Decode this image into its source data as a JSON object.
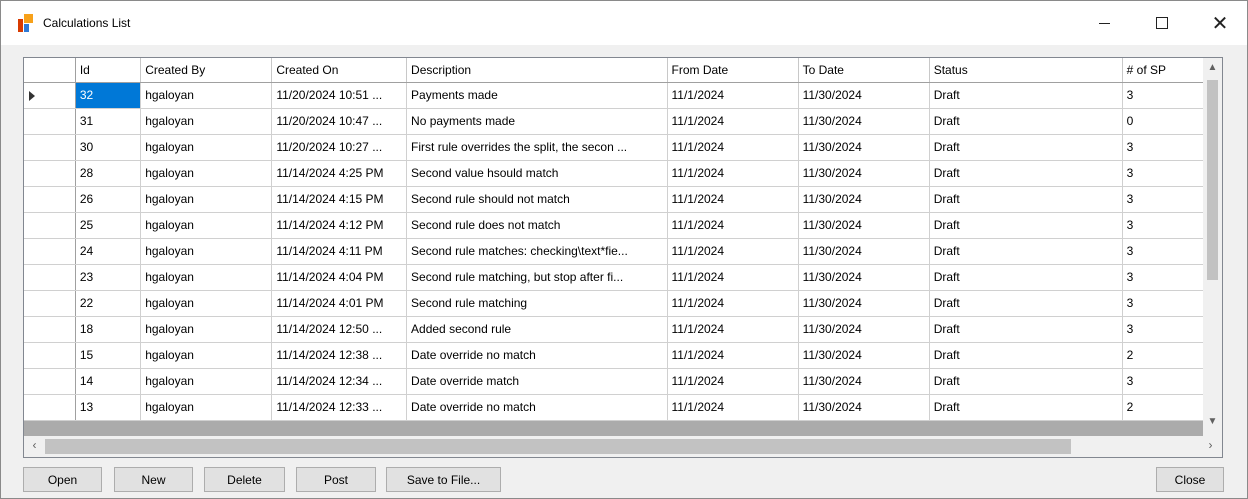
{
  "window": {
    "title": "Calculations List",
    "controls": {
      "minimize": "—",
      "maximize": "☐",
      "close": "✕"
    }
  },
  "grid": {
    "columns": [
      "Id",
      "Created By",
      "Created On",
      "Description",
      "From Date",
      "To Date",
      "Status",
      "# of SP"
    ],
    "rows": [
      {
        "id": "32",
        "created_by": "hgaloyan",
        "created_on": "11/20/2024 10:51 ...",
        "description": "Payments made",
        "from_date": "11/1/2024",
        "to_date": "11/30/2024",
        "status": "Draft",
        "sp": "3"
      },
      {
        "id": "31",
        "created_by": "hgaloyan",
        "created_on": "11/20/2024 10:47 ...",
        "description": "No payments made",
        "from_date": "11/1/2024",
        "to_date": "11/30/2024",
        "status": "Draft",
        "sp": "0"
      },
      {
        "id": "30",
        "created_by": "hgaloyan",
        "created_on": "11/20/2024 10:27 ...",
        "description": "First rule overrides the split, the secon ...",
        "from_date": "11/1/2024",
        "to_date": "11/30/2024",
        "status": "Draft",
        "sp": "3"
      },
      {
        "id": "28",
        "created_by": "hgaloyan",
        "created_on": "11/14/2024 4:25 PM",
        "description": "Second value hsould match",
        "from_date": "11/1/2024",
        "to_date": "11/30/2024",
        "status": "Draft",
        "sp": "3"
      },
      {
        "id": "26",
        "created_by": "hgaloyan",
        "created_on": "11/14/2024 4:15 PM",
        "description": "Second rule should not match",
        "from_date": "11/1/2024",
        "to_date": "11/30/2024",
        "status": "Draft",
        "sp": "3"
      },
      {
        "id": "25",
        "created_by": "hgaloyan",
        "created_on": "11/14/2024 4:12 PM",
        "description": "Second rule does not match",
        "from_date": "11/1/2024",
        "to_date": "11/30/2024",
        "status": "Draft",
        "sp": "3"
      },
      {
        "id": "24",
        "created_by": "hgaloyan",
        "created_on": "11/14/2024 4:11 PM",
        "description": "Second rule matches: checking\\text*fie...",
        "from_date": "11/1/2024",
        "to_date": "11/30/2024",
        "status": "Draft",
        "sp": "3"
      },
      {
        "id": "23",
        "created_by": "hgaloyan",
        "created_on": "11/14/2024 4:04 PM",
        "description": "Second rule matching, but stop after fi...",
        "from_date": "11/1/2024",
        "to_date": "11/30/2024",
        "status": "Draft",
        "sp": "3"
      },
      {
        "id": "22",
        "created_by": "hgaloyan",
        "created_on": "11/14/2024 4:01 PM",
        "description": "Second rule matching",
        "from_date": "11/1/2024",
        "to_date": "11/30/2024",
        "status": "Draft",
        "sp": "3"
      },
      {
        "id": "18",
        "created_by": "hgaloyan",
        "created_on": "11/14/2024 12:50 ...",
        "description": "Added second rule",
        "from_date": "11/1/2024",
        "to_date": "11/30/2024",
        "status": "Draft",
        "sp": "3"
      },
      {
        "id": "15",
        "created_by": "hgaloyan",
        "created_on": "11/14/2024 12:38 ...",
        "description": "Date override no match",
        "from_date": "11/1/2024",
        "to_date": "11/30/2024",
        "status": "Draft",
        "sp": "2"
      },
      {
        "id": "14",
        "created_by": "hgaloyan",
        "created_on": "11/14/2024 12:34 ...",
        "description": "Date override match",
        "from_date": "11/1/2024",
        "to_date": "11/30/2024",
        "status": "Draft",
        "sp": "3"
      },
      {
        "id": "13",
        "created_by": "hgaloyan",
        "created_on": "11/14/2024 12:33 ...",
        "description": "Date override no match",
        "from_date": "11/1/2024",
        "to_date": "11/30/2024",
        "status": "Draft",
        "sp": "2"
      }
    ]
  },
  "buttons": {
    "open": "Open",
    "new": "New",
    "delete": "Delete",
    "post": "Post",
    "save": "Save to File...",
    "close": "Close"
  },
  "colors": {
    "selection": "#0078d7",
    "icon_red": "#d83b01",
    "icon_orange": "#f7a11a",
    "icon_blue": "#2f7ad6"
  }
}
